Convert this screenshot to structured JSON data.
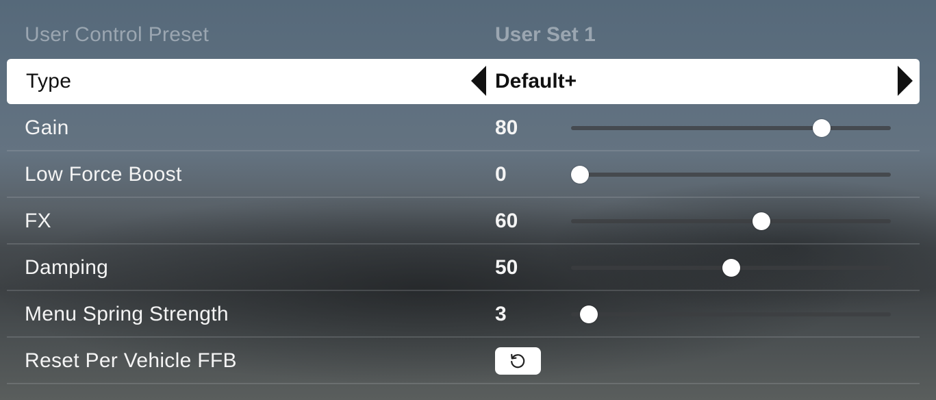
{
  "preset": {
    "label": "User Control Preset",
    "value": "User Set 1"
  },
  "type_row": {
    "label": "Type",
    "value": "Default+",
    "left_arrow_icon": "caret-left-icon",
    "right_arrow_icon": "caret-right-icon"
  },
  "settings": [
    {
      "label": "Gain",
      "value": "80",
      "min": 0,
      "max": 100,
      "level": 80
    },
    {
      "label": "Low Force Boost",
      "value": "0",
      "min": 0,
      "max": 100,
      "level": 0
    },
    {
      "label": "FX",
      "value": "60",
      "min": 0,
      "max": 100,
      "level": 60
    },
    {
      "label": "Damping",
      "value": "50",
      "min": 0,
      "max": 100,
      "level": 50
    },
    {
      "label": "Menu Spring Strength",
      "value": "3",
      "min": 0,
      "max": 100,
      "level": 3
    }
  ],
  "reset": {
    "label": "Reset Per Vehicle FFB",
    "icon": "reset-icon"
  },
  "colors": {
    "selected_bg": "#ffffff",
    "text": "#f4f4f4",
    "dim_text": "#a9b0b6",
    "slider_thumb": "#ffffff"
  }
}
